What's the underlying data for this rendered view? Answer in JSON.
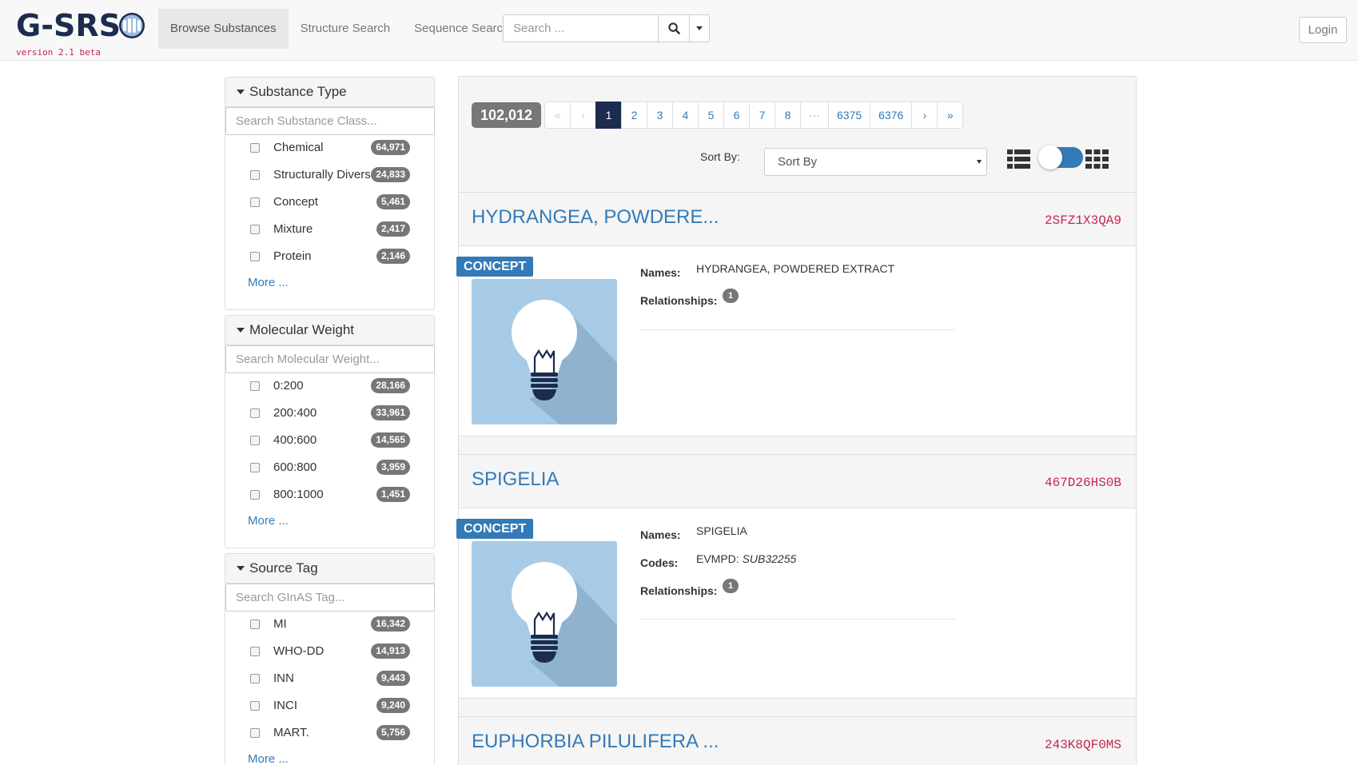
{
  "brand": {
    "name": "G-SRS",
    "version": "version 2.1 beta"
  },
  "nav": {
    "items": [
      {
        "label": "Browse Substances",
        "active": true
      },
      {
        "label": "Structure Search",
        "active": false
      },
      {
        "label": "Sequence Search",
        "active": false
      }
    ],
    "search_placeholder": "Search ...",
    "login_label": "Login"
  },
  "facets": [
    {
      "title": "Substance Type",
      "placeholder": "Search Substance Class...",
      "items": [
        {
          "label": "Chemical",
          "count": "64,971"
        },
        {
          "label": "Structurally Diverse",
          "count": "24,833"
        },
        {
          "label": "Concept",
          "count": "5,461"
        },
        {
          "label": "Mixture",
          "count": "2,417"
        },
        {
          "label": "Protein",
          "count": "2,146"
        }
      ],
      "more": "More ..."
    },
    {
      "title": "Molecular Weight",
      "placeholder": "Search Molecular Weight...",
      "items": [
        {
          "label": "0:200",
          "count": "28,166"
        },
        {
          "label": "200:400",
          "count": "33,961"
        },
        {
          "label": "400:600",
          "count": "14,565"
        },
        {
          "label": "600:800",
          "count": "3,959"
        },
        {
          "label": "800:1000",
          "count": "1,451"
        }
      ],
      "more": "More ..."
    },
    {
      "title": "Source Tag",
      "placeholder": "Search GInAS Tag...",
      "items": [
        {
          "label": "MI",
          "count": "16,342"
        },
        {
          "label": "WHO-DD",
          "count": "14,913"
        },
        {
          "label": "INN",
          "count": "9,443"
        },
        {
          "label": "INCI",
          "count": "9,240"
        },
        {
          "label": "MART.",
          "count": "5,756"
        }
      ],
      "more": "More ..."
    }
  ],
  "results_header": {
    "total": "102,012",
    "pages": [
      "«",
      "‹",
      "1",
      "2",
      "3",
      "4",
      "5",
      "6",
      "7",
      "8",
      "···",
      "6375",
      "6376",
      "›",
      "»"
    ],
    "sort_label": "Sort By:",
    "sort_value": "Sort By"
  },
  "results": [
    {
      "title": "HYDRANGEA, POWDERE...",
      "unii": "2SFZ1X3QA9",
      "type": "CONCEPT",
      "names_label": "Names:",
      "names": "HYDRANGEA, POWDERED EXTRACT",
      "relationships_label": "Relationships:",
      "relationships": "1"
    },
    {
      "title": "SPIGELIA",
      "unii": "467D26HS0B",
      "type": "CONCEPT",
      "names_label": "Names:",
      "names": "SPIGELIA",
      "codes_label": "Codes:",
      "codes_system": "EVMPD:",
      "codes_value": "SUB32255",
      "relationships_label": "Relationships:",
      "relationships": "1"
    },
    {
      "title": "EUPHORBIA PILULIFERA ...",
      "unii": "243K8QF0MS"
    }
  ],
  "colors": {
    "brand_navy": "#1b2c4f",
    "link_blue": "#337ab7",
    "unii_red": "#c7254e",
    "badge_gray": "#777777",
    "thumb_bg": "#a7cbe6"
  },
  "icons": {
    "search": "search-icon",
    "list_view": "list-view-icon",
    "grid_view": "grid-view-icon",
    "concept": "lightbulb-icon"
  }
}
